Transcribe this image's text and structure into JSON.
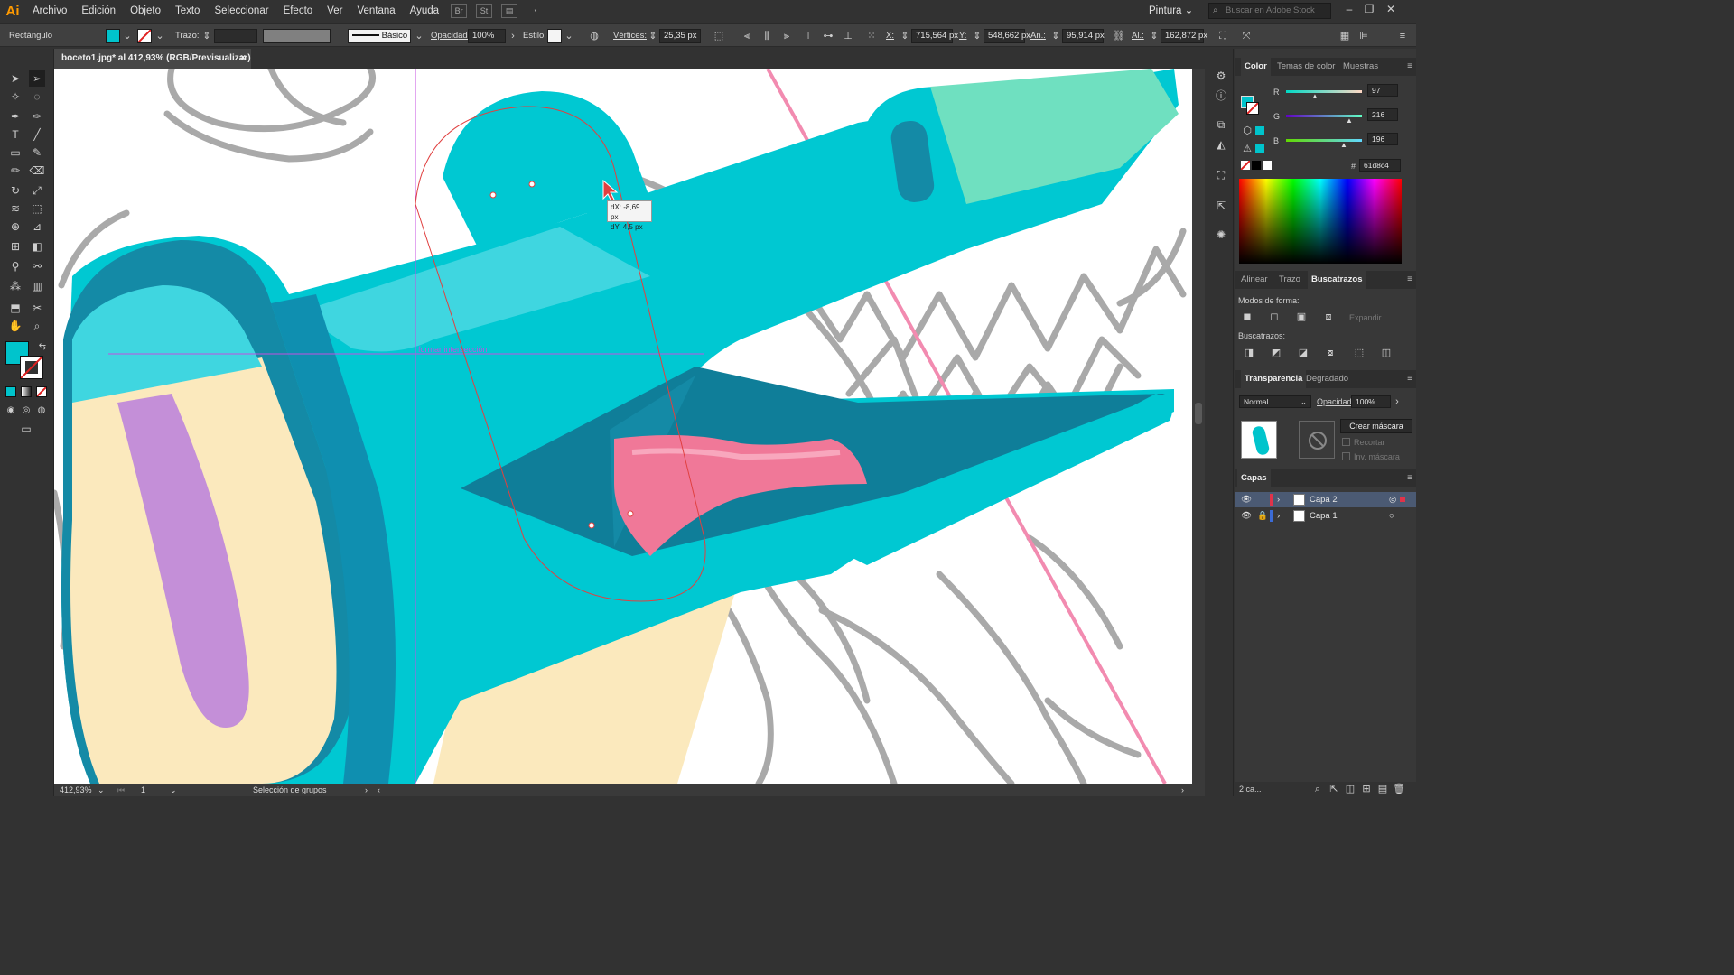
{
  "app": {
    "logo": "Ai",
    "workspace": "Pintura",
    "stock_search_placeholder": "Buscar en Adobe Stock"
  },
  "menu": [
    "Archivo",
    "Edición",
    "Objeto",
    "Texto",
    "Seleccionar",
    "Efecto",
    "Ver",
    "Ventana",
    "Ayuda"
  ],
  "menu_icons": [
    "bridge-icon",
    "stock-icon",
    "arrange-documents-icon",
    "gpu-icon"
  ],
  "control_bar": {
    "selection_label": "Rectángulo",
    "fill_color": "#61d8c4",
    "stroke_label": "Trazo:",
    "stroke_style": "Básico",
    "opacity_label": "Opacidad:",
    "opacity_value": "100%",
    "style_label": "Estilo:",
    "vertices_label": "Vértices:",
    "vertices_value": "25,35 px",
    "x_label": "X:",
    "x_value": "715,564 px",
    "y_label": "Y:",
    "y_value": "548,662 px",
    "w_label": "An.:",
    "w_value": "95,914 px",
    "h_label": "Al.:",
    "h_value": "162,872 px"
  },
  "document_tab": {
    "title": "boceto1.jpg* al 412,93% (RGB/Previsualizar)",
    "close": "×"
  },
  "canvas": {
    "tooltip_dx": "dX: -8,69 px",
    "tooltip_dy": "dY: 4,5 px",
    "guide_label": "formar intersección"
  },
  "status": {
    "zoom": "412,93%",
    "artboard": "1",
    "mode": "Selección de grupos"
  },
  "color_panel": {
    "tabs": [
      "Color",
      "Temas de color",
      "Muestras"
    ],
    "r_label": "R",
    "r_value": "97",
    "g_label": "G",
    "g_value": "216",
    "b_label": "B",
    "b_value": "196",
    "hex_label": "#",
    "hex_value": "61d8c4"
  },
  "pathfinder_panel": {
    "tabs": [
      "Alinear",
      "Trazo",
      "Buscatrazos"
    ],
    "shape_modes_label": "Modos de forma:",
    "expand_label": "Expandir",
    "pathfinders_label": "Buscatrazos:"
  },
  "transparency_panel": {
    "tabs": [
      "Transparencia",
      "Degradado"
    ],
    "blend_mode": "Normal",
    "opacity_label": "Opacidad:",
    "opacity_value": "100%",
    "make_mask": "Crear máscara",
    "clip": "Recortar",
    "invert_mask": "Inv. máscara"
  },
  "layers_panel": {
    "title": "Capas",
    "layers": [
      {
        "name": "Capa 2",
        "color": "#e0334a"
      },
      {
        "name": "Capa 1",
        "color": "#3b6bd6"
      }
    ],
    "footer_count": "2 ca..."
  },
  "colors": {
    "cyan": "#00c8d2",
    "cyan_light": "#3fd6e0",
    "teal_dark": "#148aa6",
    "mouth_dark": "#0f7e99",
    "tongue": "#f07898",
    "cream": "#fbe9bd",
    "purple": "#c48fd8",
    "mint": "#6fe0c0",
    "sketch": "#9a9a9a",
    "pink_line": "#f28bb0",
    "guide": "#c44fe0",
    "path_red": "#e04040"
  }
}
